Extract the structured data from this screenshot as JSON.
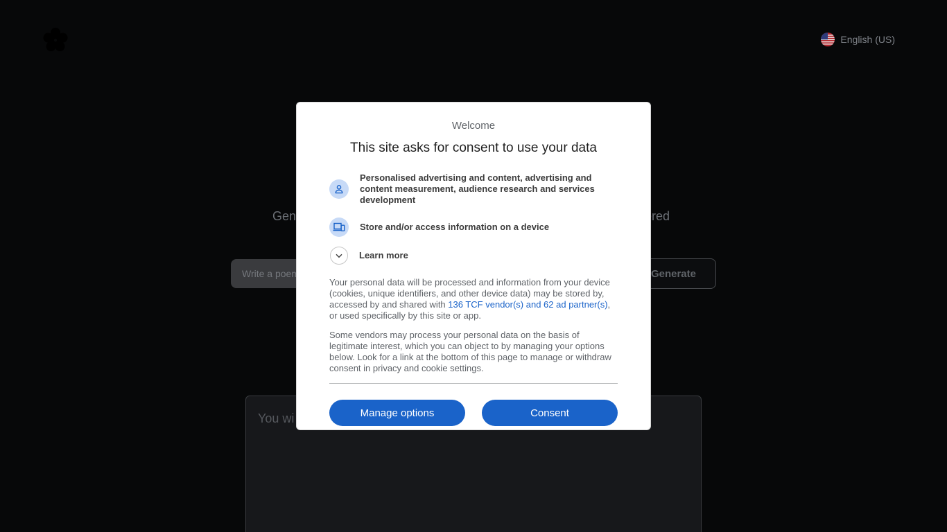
{
  "header": {
    "language_label": "English (US)"
  },
  "main": {
    "subtitle_left": "Gene",
    "subtitle_right": "ered",
    "prompt_placeholder": "Write a poem",
    "generate_label": "Generate",
    "output_placeholder": "You wi"
  },
  "consent": {
    "welcome": "Welcome",
    "title": "This site asks for consent to use your data",
    "purposes": [
      {
        "icon": "person-icon",
        "text": "Personalised advertising and content, advertising and content measurement, audience research and services development"
      },
      {
        "icon": "devices-icon",
        "text": "Store and/or access information on a device"
      }
    ],
    "learn_more": "Learn more",
    "paragraph1_before": "Your personal data will be processed and information from your device (cookies, unique identifiers, and other device data) may be stored by, accessed by and shared with ",
    "paragraph1_link": "136 TCF vendor(s) and 62 ad partner(s)",
    "paragraph1_after": ", or used specifically by this site or app.",
    "paragraph2": "Some vendors may process your personal data on the basis of legitimate interest, which you can object to by managing your options below. Look for a link at the bottom of this page to manage or withdraw consent in privacy and cookie settings.",
    "manage_options_label": "Manage options",
    "consent_label": "Consent"
  },
  "colors": {
    "accent": "#1a63c9",
    "icon_bg": "#c7daf7",
    "page_bg": "#070809"
  }
}
